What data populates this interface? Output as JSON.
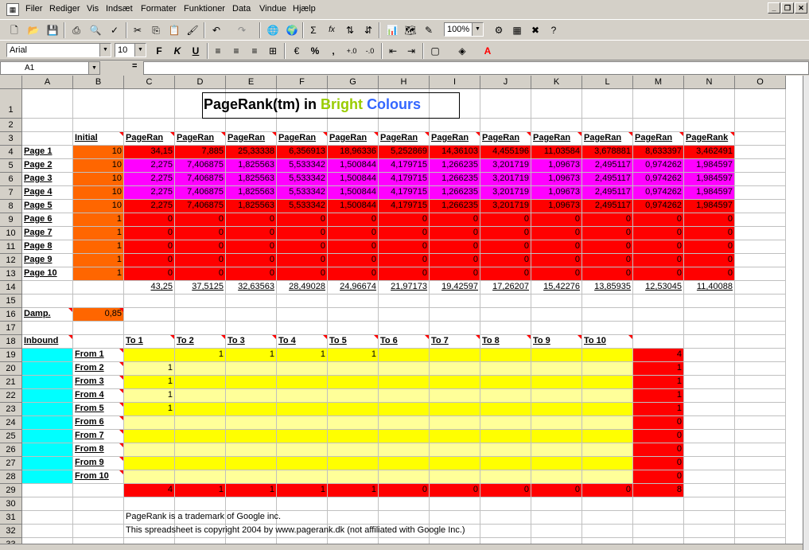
{
  "menu": [
    "Filer",
    "Rediger",
    "Vis",
    "Indsæt",
    "Formater",
    "Funktioner",
    "Data",
    "Vindue",
    "Hjælp"
  ],
  "toolbar": {
    "zoom": "100%",
    "font": "Arial",
    "font_size": "10",
    "bold": "F",
    "italic": "K",
    "underline": "U",
    "percent": "%",
    "sum": "Σ",
    "fx": "fx"
  },
  "formula": {
    "cell_ref": "A1",
    "eq": "="
  },
  "columns": [
    "A",
    "B",
    "C",
    "D",
    "E",
    "F",
    "G",
    "H",
    "I",
    "J",
    "K",
    "L",
    "M",
    "N",
    "O"
  ],
  "rows": [
    "1",
    "2",
    "3",
    "4",
    "5",
    "6",
    "7",
    "8",
    "9",
    "10",
    "11",
    "12",
    "13",
    "14",
    "15",
    "16",
    "17",
    "18",
    "19",
    "20",
    "21",
    "22",
    "23",
    "24",
    "25",
    "26",
    "27",
    "28",
    "29",
    "30",
    "31",
    "32",
    "33"
  ],
  "title": {
    "part1": "PageRank(tm) in",
    "part2": "Bright",
    "part3": "Colours",
    "color_bright": "#99cc00",
    "color_colours": "#3366ff"
  },
  "header_initial": "Initial",
  "pagerank_headers": [
    "PageRan",
    "PageRan",
    "PageRan",
    "PageRan",
    "PageRan",
    "PageRan",
    "PageRan",
    "PageRan",
    "PageRan",
    "PageRan",
    "PageRan",
    "PageRank"
  ],
  "pages": [
    {
      "name": "Page 1",
      "initial": "10",
      "vals": [
        "34,15",
        "7,885",
        "25,33338",
        "6,356913",
        "18,96336",
        "5,252869",
        "14,36103",
        "4,455196",
        "11,03584",
        "3,678881",
        "8,633397",
        "3,462491"
      ]
    },
    {
      "name": "Page 2",
      "initial": "10",
      "vals": [
        "2,275",
        "7,406875",
        "1,825563",
        "5,533342",
        "1,500844",
        "4,179715",
        "1,266235",
        "3,201719",
        "1,09673",
        "2,495117",
        "0,974262",
        "1,984597"
      ]
    },
    {
      "name": "Page 3",
      "initial": "10",
      "vals": [
        "2,275",
        "7,406875",
        "1,825563",
        "5,533342",
        "1,500844",
        "4,179715",
        "1,266235",
        "3,201719",
        "1,09673",
        "2,495117",
        "0,974262",
        "1,984597"
      ]
    },
    {
      "name": "Page 4",
      "initial": "10",
      "vals": [
        "2,275",
        "7,406875",
        "1,825563",
        "5,533342",
        "1,500844",
        "4,179715",
        "1,266235",
        "3,201719",
        "1,09673",
        "2,495117",
        "0,974262",
        "1,984597"
      ]
    },
    {
      "name": "Page 5",
      "initial": "10",
      "vals": [
        "2,275",
        "7,406875",
        "1,825563",
        "5,533342",
        "1,500844",
        "4,179715",
        "1,266235",
        "3,201719",
        "1,09673",
        "2,495117",
        "0,974262",
        "1,984597"
      ]
    },
    {
      "name": "Page 6",
      "initial": "1",
      "vals": [
        "0",
        "0",
        "0",
        "0",
        "0",
        "0",
        "0",
        "0",
        "0",
        "0",
        "0",
        "0"
      ]
    },
    {
      "name": "Page 7",
      "initial": "1",
      "vals": [
        "0",
        "0",
        "0",
        "0",
        "0",
        "0",
        "0",
        "0",
        "0",
        "0",
        "0",
        "0"
      ]
    },
    {
      "name": "Page 8",
      "initial": "1",
      "vals": [
        "0",
        "0",
        "0",
        "0",
        "0",
        "0",
        "0",
        "0",
        "0",
        "0",
        "0",
        "0"
      ]
    },
    {
      "name": "Page 9",
      "initial": "1",
      "vals": [
        "0",
        "0",
        "0",
        "0",
        "0",
        "0",
        "0",
        "0",
        "0",
        "0",
        "0",
        "0"
      ]
    },
    {
      "name": "Page 10",
      "initial": "1",
      "vals": [
        "0",
        "0",
        "0",
        "0",
        "0",
        "0",
        "0",
        "0",
        "0",
        "0",
        "0",
        "0"
      ]
    }
  ],
  "totals": [
    "43,25",
    "37,5125",
    "32,63563",
    "28,49028",
    "24,96674",
    "21,97173",
    "19,42597",
    "17,26207",
    "15,42276",
    "13,85935",
    "12,53045",
    "11,40088"
  ],
  "damp": {
    "label": "Damp.",
    "value": "0,85"
  },
  "inbound": {
    "label": "Inbound",
    "to_headers": [
      "To 1",
      "To 2",
      "To 3",
      "To 4",
      "To 5",
      "To 6",
      "To 7",
      "To 8",
      "To 9",
      "To 10"
    ],
    "rows": [
      {
        "from": "From 1",
        "cells": [
          "",
          "1",
          "1",
          "1",
          "1",
          "",
          "",
          "",
          "",
          ""
        ],
        "sum": "4"
      },
      {
        "from": "From 2",
        "cells": [
          "1",
          "",
          "",
          "",
          "",
          "",
          "",
          "",
          "",
          ""
        ],
        "sum": "1"
      },
      {
        "from": "From 3",
        "cells": [
          "1",
          "",
          "",
          "",
          "",
          "",
          "",
          "",
          "",
          ""
        ],
        "sum": "1"
      },
      {
        "from": "From 4",
        "cells": [
          "1",
          "",
          "",
          "",
          "",
          "",
          "",
          "",
          "",
          ""
        ],
        "sum": "1"
      },
      {
        "from": "From 5",
        "cells": [
          "1",
          "",
          "",
          "",
          "",
          "",
          "",
          "",
          "",
          ""
        ],
        "sum": "1"
      },
      {
        "from": "From 6",
        "cells": [
          "",
          "",
          "",
          "",
          "",
          "",
          "",
          "",
          "",
          ""
        ],
        "sum": "0"
      },
      {
        "from": "From 7",
        "cells": [
          "",
          "",
          "",
          "",
          "",
          "",
          "",
          "",
          "",
          ""
        ],
        "sum": "0"
      },
      {
        "from": "From 8",
        "cells": [
          "",
          "",
          "",
          "",
          "",
          "",
          "",
          "",
          "",
          ""
        ],
        "sum": "0"
      },
      {
        "from": "From 9",
        "cells": [
          "",
          "",
          "",
          "",
          "",
          "",
          "",
          "",
          "",
          ""
        ],
        "sum": "0"
      },
      {
        "from": "From 10",
        "cells": [
          "",
          "",
          "",
          "",
          "",
          "",
          "",
          "",
          "",
          ""
        ],
        "sum": "0"
      }
    ],
    "col_sums": [
      "4",
      "1",
      "1",
      "1",
      "1",
      "0",
      "0",
      "0",
      "0",
      "0"
    ],
    "grand_total": "8"
  },
  "footer": [
    "PageRank is a trademark of Google inc.",
    "This spreadsheet is copyright 2004 by www.pagerank.dk (not affiliated with Google Inc.)"
  ]
}
